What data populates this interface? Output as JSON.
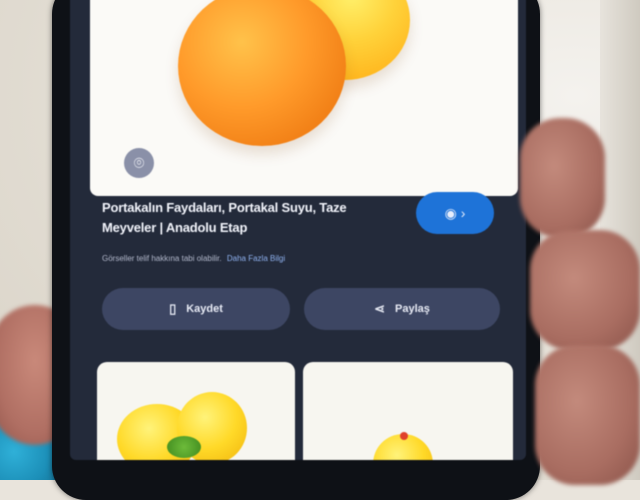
{
  "hero": {
    "lens_icon": "google-lens-icon"
  },
  "result": {
    "title": "Portakalın Faydaları, Portakal Suyu, Taze Meyveler | Anadolu Etap",
    "visit_icon": "globe-arrow-icon",
    "caption_text": "Görseller telif hakkına tabi olabilir.",
    "caption_link": "Daha Fazla Bilgi"
  },
  "actions": {
    "save_label": "Kaydet",
    "save_icon": "bookmark-icon",
    "share_label": "Paylaş",
    "share_icon": "share-icon"
  },
  "colors": {
    "screen_bg": "#232a3a",
    "accent": "#1e73d8",
    "button_bg": "#3d4663"
  }
}
